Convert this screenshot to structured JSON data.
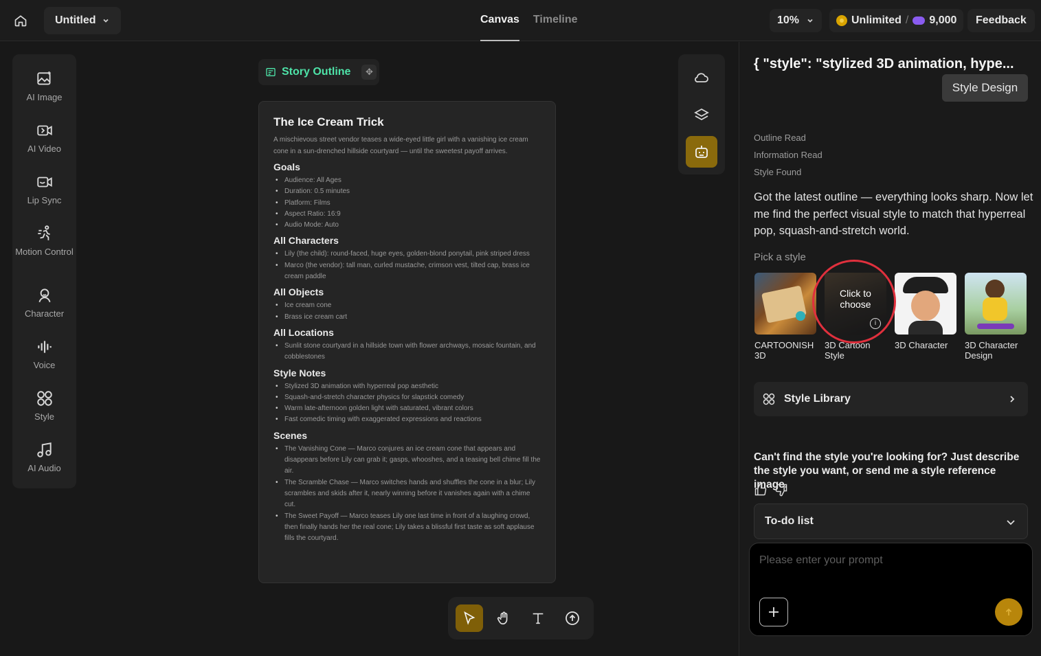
{
  "header": {
    "project_title": "Untitled",
    "tabs": [
      {
        "label": "Canvas",
        "active": true
      },
      {
        "label": "Timeline",
        "active": false
      }
    ],
    "zoom": "10%",
    "credits": {
      "plan": "Unlimited",
      "separator": "/",
      "points": "9,000"
    },
    "feedback_label": "Feedback"
  },
  "rail": {
    "items": [
      {
        "label": "AI Image",
        "icon": "image-sparkle-icon"
      },
      {
        "label": "AI Video",
        "icon": "video-sparkle-icon"
      },
      {
        "label": "Lip Sync",
        "icon": "lip-sync-icon"
      },
      {
        "label": "Motion Control",
        "icon": "motion-runner-icon"
      },
      {
        "label": "Character",
        "icon": "character-icon"
      },
      {
        "label": "Voice",
        "icon": "voice-wave-icon"
      },
      {
        "label": "Style",
        "icon": "style-grid-icon"
      },
      {
        "label": "AI Audio",
        "icon": "music-note-icon"
      }
    ]
  },
  "canvas": {
    "outline_chip_label": "Story Outline",
    "card": {
      "title": "The Ice Cream Trick",
      "summary": "A mischievous street vendor teases a wide-eyed little girl with a vanishing ice cream cone in a sun-drenched hillside courtyard — until the sweetest payoff arrives.",
      "sections": [
        {
          "heading": "Goals",
          "items": [
            "Audience: All Ages",
            "Duration: 0.5 minutes",
            "Platform: Films",
            "Aspect Ratio: 16:9",
            "Audio Mode: Auto"
          ]
        },
        {
          "heading": "All Characters",
          "items": [
            "Lily (the child): round-faced, huge eyes, golden-blond ponytail, pink striped dress",
            "Marco (the vendor): tall man, curled mustache, crimson vest, tilted cap, brass ice cream paddle"
          ]
        },
        {
          "heading": "All Objects",
          "items": [
            "Ice cream cone",
            "Brass ice cream cart"
          ]
        },
        {
          "heading": "All Locations",
          "items": [
            "Sunlit stone courtyard in a hillside town with flower archways, mosaic fountain, and cobblestones"
          ]
        },
        {
          "heading": "Style Notes",
          "items": [
            "Stylized 3D animation with hyperreal pop aesthetic",
            "Squash-and-stretch character physics for slapstick comedy",
            "Warm late-afternoon golden light with saturated, vibrant colors",
            "Fast comedic timing with exaggerated expressions and reactions"
          ]
        },
        {
          "heading": "Scenes",
          "items": [
            "The Vanishing Cone — Marco conjures an ice cream cone that appears and disappears before Lily can grab it; gasps, whooshes, and a teasing bell chime fill the air.",
            "The Scramble Chase — Marco switches hands and shuffles the cone in a blur; Lily scrambles and skids after it, nearly winning before it vanishes again with a chime cut.",
            "The Sweet Payoff — Marco teases Lily one last time in front of a laughing crowd, then finally hands her the real cone; Lily takes a blissful first taste as soft applause fills the courtyard."
          ]
        }
      ]
    },
    "side_tools": [
      "cloud-icon",
      "layers-icon",
      "robot-assistant-icon"
    ],
    "bottom_tools": [
      "pointer-icon",
      "hand-pan-icon",
      "text-tool-icon",
      "upload-icon"
    ]
  },
  "panel": {
    "title": "{ \"style\": \"stylized 3D animation, hype...",
    "style_design_label": "Style Design",
    "status_steps": [
      "Outline Read",
      "Information Read",
      "Style Found"
    ],
    "message": "Got the latest outline — everything looks sharp. Now let me find the perfect visual style to match that hyperreal pop, squash-and-stretch world.",
    "pick_label": "Pick a style",
    "style_options": [
      {
        "name": "CARTOONISH 3D"
      },
      {
        "name": "3D Cartoon Style",
        "overlay": "Click to choose"
      },
      {
        "name": "3D Character"
      },
      {
        "name": "3D Character Design"
      }
    ],
    "style_library_label": "Style Library",
    "hint": "Can't find the style you're looking for? Just describe the style you want, or send me a style reference image.",
    "todo_label": "To-do list",
    "prompt_placeholder": "Please enter your prompt"
  },
  "colors": {
    "accent_green": "#4ee3a8",
    "accent_gold": "#b8860b",
    "highlight_ring": "#e0303d"
  }
}
